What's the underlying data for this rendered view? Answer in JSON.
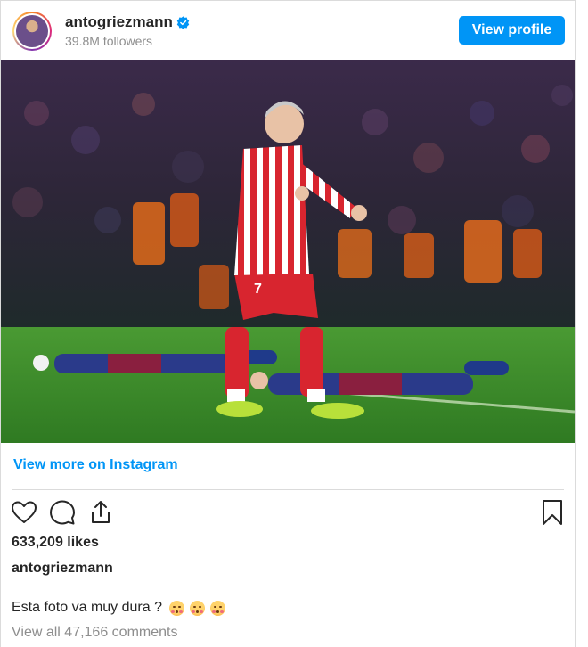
{
  "header": {
    "username": "antogriezmann",
    "followers": "39.8M followers",
    "view_profile_label": "View profile"
  },
  "photo": {
    "jersey_number": "7",
    "colors": {
      "pitch": "#3e8a2a",
      "stripe_red": "#d8252f",
      "away_blue": "#1f3a8a",
      "away_garnet": "#8a1f3f",
      "boots": "#b8e03a"
    }
  },
  "view_more_label": "View more on Instagram",
  "actions": {
    "like_icon": "heart-icon",
    "comment_icon": "comment-icon",
    "share_icon": "share-icon",
    "save_icon": "bookmark-icon"
  },
  "likes": "633,209 likes",
  "caption": {
    "username": "antogriezmann",
    "text": "Esta foto va muy dura ?",
    "emojis": [
      "kissing-face-emoji",
      "kissing-face-emoji",
      "kissing-face-emoji"
    ]
  },
  "comments_label": "View all 47,166 comments",
  "colors": {
    "accent": "#0095f6",
    "text": "#262626",
    "muted": "#8e8e8e",
    "border": "#dbdbdb"
  }
}
